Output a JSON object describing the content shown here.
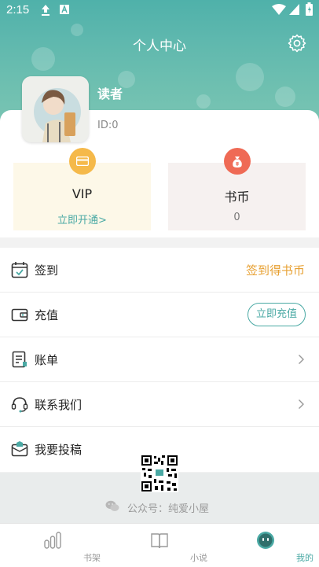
{
  "status": {
    "time": "2:15"
  },
  "header": {
    "title": "个人中心"
  },
  "user": {
    "name": "读者",
    "id": "ID:0"
  },
  "cards": {
    "vip": {
      "title": "VIP",
      "sub": "立即开通>"
    },
    "coin": {
      "title": "书币",
      "sub": "0"
    }
  },
  "menu": {
    "items": [
      {
        "label": "签到",
        "right_text": "签到得书币"
      },
      {
        "label": "充值",
        "button": "立即充值"
      },
      {
        "label": "账单"
      },
      {
        "label": "联系我们"
      },
      {
        "label": "我要投稿"
      }
    ]
  },
  "footer": {
    "public_account": "公众号：纯爱小屋"
  },
  "nav": {
    "items": [
      {
        "label": "书架"
      },
      {
        "label": "小说"
      },
      {
        "label": "我的"
      }
    ]
  },
  "colors": {
    "accent": "#4aa9a4",
    "orange": "#e7a032",
    "vip": "#f5b94a",
    "coin": "#ef6a55"
  }
}
